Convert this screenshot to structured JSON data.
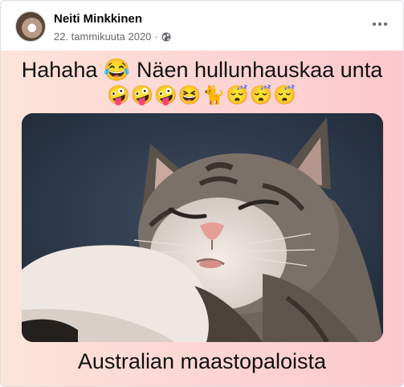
{
  "post": {
    "author": "Neiti Minkkinen",
    "date": "22. tammikuuta 2020",
    "separator": "·",
    "audience_icon": "globe-icon",
    "menu_icon": "more-options-icon"
  },
  "image": {
    "caption_top": "Hahaha 😂 Näen hullunhauskaa unta",
    "emoji_row": "🤪🤪🤪😆🐈😴😴😴",
    "caption_bottom": "Australian maastopaloista",
    "photo_subject": "sleeping-cat"
  },
  "colors": {
    "meta_text": "#65676b",
    "author_text": "#050505",
    "bg_left": "#fde4d9",
    "bg_right": "#fcc8cc"
  }
}
